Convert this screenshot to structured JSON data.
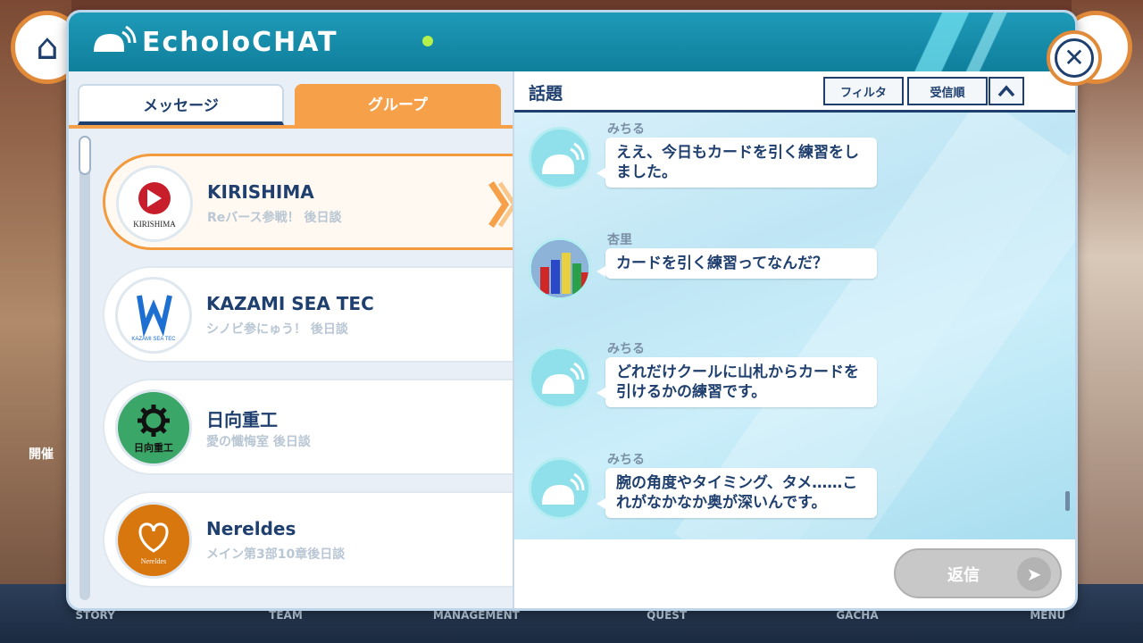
{
  "app": {
    "title": "EcholoCHAT"
  },
  "background": {
    "left_label": "開催",
    "nav": [
      "STORY",
      "TEAM",
      "MANAGEMENT",
      "QUEST",
      "GACHA",
      "MENU"
    ]
  },
  "tabs": {
    "messages": "メッセージ",
    "groups": "グループ",
    "active": "groups"
  },
  "groups": [
    {
      "name": "KIRISHIMA",
      "sub": "Reバース参戦！ 後日談",
      "avatar_text": "KIRISHIMA",
      "avatar_color": "#ffffff",
      "selected": true
    },
    {
      "name": "KAZAMI SEA TEC",
      "sub": "シノビ参にゅう！ 後日談",
      "avatar_text": "KAZAMI SEA TEC",
      "avatar_color": "#ffffff",
      "selected": false
    },
    {
      "name": "日向重工",
      "sub": "愛の懺悔室 後日談",
      "avatar_text": "日向重工",
      "avatar_color": "#3aa668",
      "selected": false
    },
    {
      "name": "Nereldes",
      "sub": "メイン第3部10章後日談",
      "avatar_text": "Nereldes",
      "avatar_color": "#d9770f",
      "selected": false
    }
  ],
  "topic": {
    "title": "話題",
    "filter_label": "フィルタ",
    "sort_label": "受信順",
    "up_icon": "chevron-up-icon"
  },
  "messages": [
    {
      "sender": "みちる",
      "text": "ええ、今日もカードを引く練習をしました。",
      "avatar": "whale"
    },
    {
      "sender": "杏里",
      "text": "カードを引く練習ってなんだ？",
      "avatar": "chips"
    },
    {
      "sender": "みちる",
      "text": "どれだけクールに山札からカードを引けるかの練習です。",
      "avatar": "whale"
    },
    {
      "sender": "みちる",
      "text": "腕の角度やタイミング、タメ……これがなかなか奥が深いんです。",
      "avatar": "whale"
    }
  ],
  "reply": {
    "label": "返信",
    "enabled": false
  },
  "colors": {
    "accent": "#f6a04a",
    "navy": "#1f3f6e",
    "header": "#1e9ab8"
  }
}
